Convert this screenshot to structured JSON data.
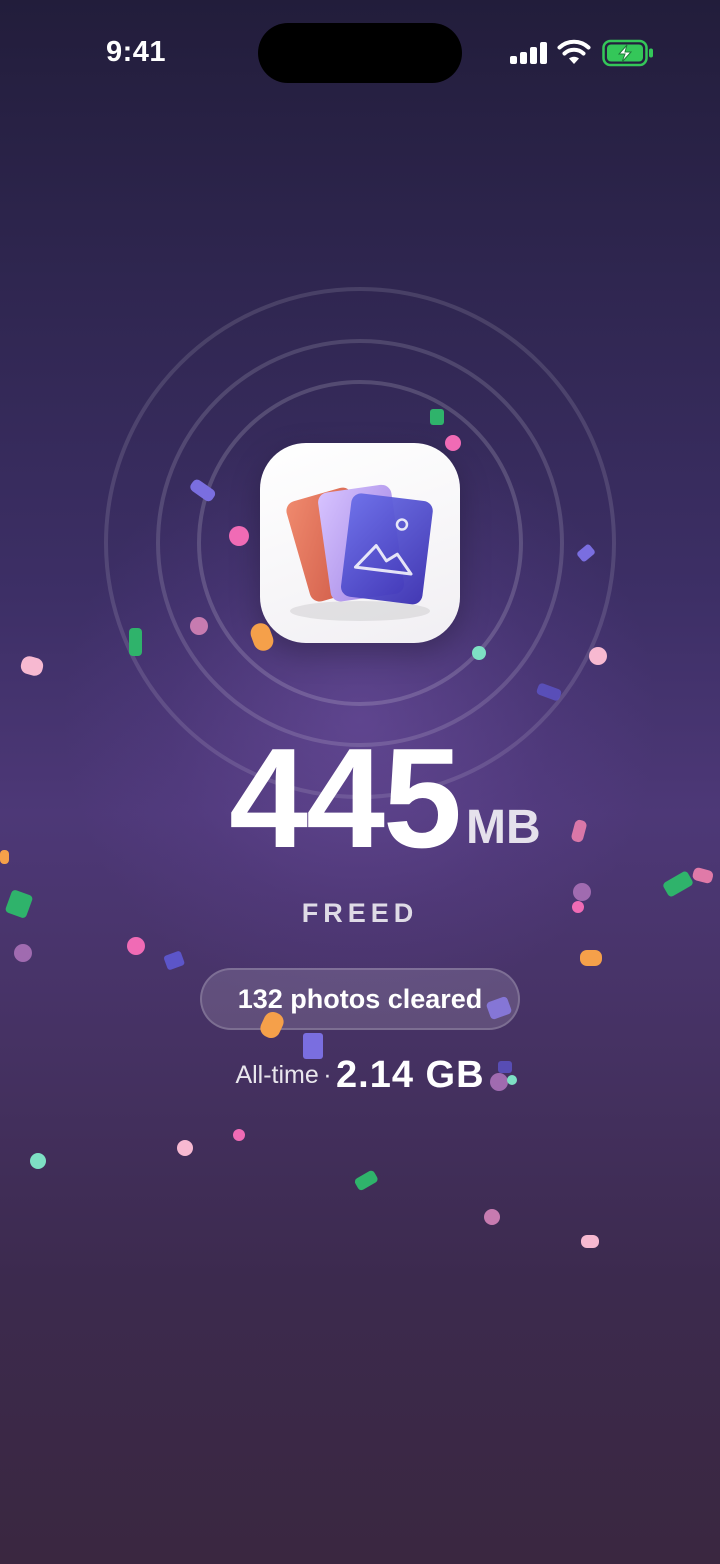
{
  "status_bar": {
    "time": "9:41",
    "icons": [
      "cellular-signal-icon",
      "wifi-icon",
      "battery-charging-icon"
    ],
    "battery_color": "#34c759"
  },
  "result": {
    "amount": "445",
    "unit": "MB",
    "label": "FREED",
    "photos_cleared": "132 photos cleared",
    "alltime_label": "All-time",
    "alltime_separator": "·",
    "alltime_value": "2.14 GB"
  },
  "app_icon": {
    "name": "photo-cards-icon"
  },
  "colors": {
    "background_top": "#221d3b",
    "background_mid": "#4d3877",
    "background_bottom": "#3a2740",
    "confetti": [
      "#f06bb5",
      "#2fb36b",
      "#7a6ee0",
      "#f5a04a",
      "#7ee0c4",
      "#f7b9d1",
      "#a06bb0"
    ]
  }
}
